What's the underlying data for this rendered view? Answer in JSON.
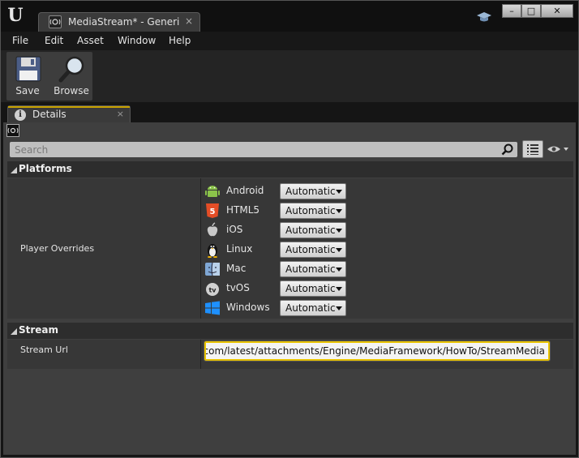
{
  "window": {
    "tab_title": "MediaStream* - Generic A",
    "tab_close": "×",
    "min_label": "–",
    "max_label": "□",
    "close_label": "✕"
  },
  "menu": {
    "items": [
      "File",
      "Edit",
      "Asset",
      "Window",
      "Help"
    ]
  },
  "toolbar": {
    "save_label": "Save",
    "browse_label": "Browse"
  },
  "details": {
    "tab_label": "Details",
    "tab_close": "×",
    "search_placeholder": "Search"
  },
  "platforms": {
    "category_label": "Platforms",
    "property_label": "Player Overrides",
    "rows": [
      {
        "name": "Android",
        "value": "Automatic",
        "icon": "android-icon"
      },
      {
        "name": "HTML5",
        "value": "Automatic",
        "icon": "html5-icon"
      },
      {
        "name": "iOS",
        "value": "Automatic",
        "icon": "apple-icon"
      },
      {
        "name": "Linux",
        "value": "Automatic",
        "icon": "linux-penguin-icon"
      },
      {
        "name": "Mac",
        "value": "Automatic",
        "icon": "mac-finder-icon"
      },
      {
        "name": "tvOS",
        "value": "Automatic",
        "icon": "apple-tv-icon"
      },
      {
        "name": "Windows",
        "value": "Automatic",
        "icon": "windows-icon"
      }
    ]
  },
  "stream": {
    "category_label": "Stream",
    "property_label": "Stream Url",
    "url_value": "alengine.com/latest/attachments/Engine/MediaFramework/HowTo/StreamMedia"
  },
  "colors": {
    "accent": "#e8c200",
    "panel_bg": "#3f3f3f",
    "title_bg": "#101010"
  }
}
